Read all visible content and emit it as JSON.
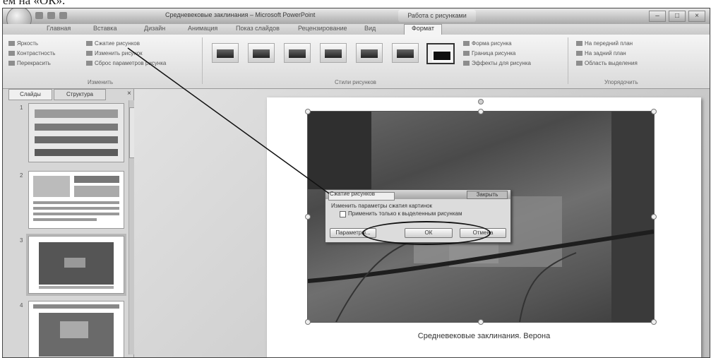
{
  "caption_top": "ем на «ОК».",
  "window": {
    "doc_title": "Средневековые заклинания – Microsoft PowerPoint",
    "tools_title": "Работа с рисунками",
    "controls": [
      "–",
      "□",
      "×"
    ]
  },
  "tabs": [
    "Главная",
    "Вставка",
    "Дизайн",
    "Анимация",
    "Показ слайдов",
    "Рецензирование",
    "Вид",
    "Формат"
  ],
  "active_tab": "Формат",
  "ribbon": {
    "adjust": [
      "Яркость",
      "Контрастность",
      "Перекрасить"
    ],
    "compress": [
      "Сжатие рисунков",
      "Изменить рисунок",
      "Сброс параметров рисунка"
    ],
    "adjust_group": "Изменить",
    "styles_group": "Стили рисунков",
    "effects": [
      "Форма рисунка",
      "Граница рисунка",
      "Эффекты для рисунка"
    ],
    "arrange": [
      "На передний план",
      "На задний план",
      "Область выделения"
    ],
    "arrange_group": "Упорядочить"
  },
  "left_panel": {
    "tabs": [
      "Слайды",
      "Структура"
    ],
    "close": "×",
    "slide_numbers": [
      "1",
      "2",
      "3",
      "4"
    ]
  },
  "slide": {
    "caption": "Средневековые заклинания. Верона"
  },
  "dialog": {
    "title": "Сжатие рисунков",
    "close_label": "Закрыть",
    "prompt": "Изменить параметры сжатия картинок",
    "checkbox_label": "Применить только к выделенным рисункам",
    "buttons": [
      "Параметры...",
      "ОК",
      "Отмена"
    ]
  }
}
